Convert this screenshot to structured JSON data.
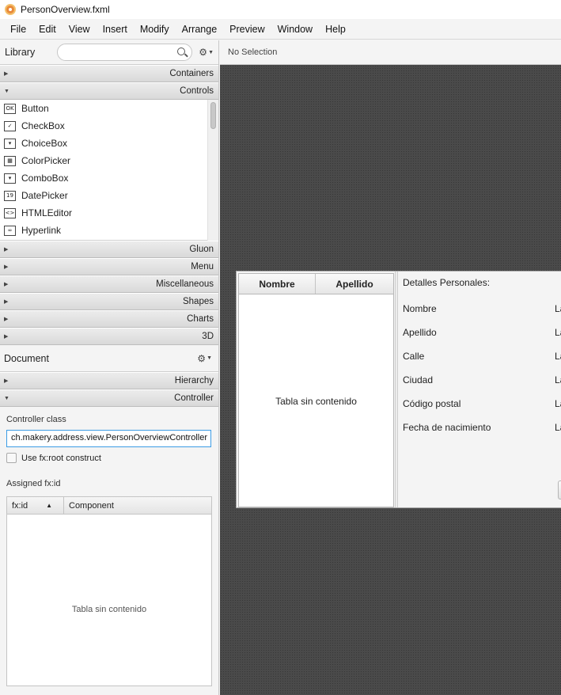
{
  "window": {
    "title": "PersonOverview.fxml"
  },
  "menu": [
    "File",
    "Edit",
    "View",
    "Insert",
    "Modify",
    "Arrange",
    "Preview",
    "Window",
    "Help"
  ],
  "library": {
    "title": "Library",
    "search_placeholder": "",
    "sections_top": [
      {
        "label": "Containers",
        "expanded": false
      },
      {
        "label": "Controls",
        "expanded": true
      }
    ],
    "controls": [
      {
        "label": "Button",
        "icon": "button-icon",
        "glyph": "OK"
      },
      {
        "label": "CheckBox",
        "icon": "checkbox-icon",
        "glyph": "✓"
      },
      {
        "label": "ChoiceBox",
        "icon": "choicebox-icon",
        "glyph": "▾"
      },
      {
        "label": "ColorPicker",
        "icon": "colorpicker-icon",
        "glyph": "▦"
      },
      {
        "label": "ComboBox",
        "icon": "combobox-icon",
        "glyph": "▾"
      },
      {
        "label": "DatePicker",
        "icon": "datepicker-icon",
        "glyph": "19"
      },
      {
        "label": "HTMLEditor",
        "icon": "htmleditor-icon",
        "glyph": "<>"
      },
      {
        "label": "Hyperlink",
        "icon": "hyperlink-icon",
        "glyph": "∞"
      }
    ],
    "sections_bottom": [
      {
        "label": "Gluon"
      },
      {
        "label": "Menu"
      },
      {
        "label": "Miscellaneous"
      },
      {
        "label": "Shapes"
      },
      {
        "label": "Charts"
      },
      {
        "label": "3D"
      }
    ]
  },
  "document": {
    "title": "Document",
    "sections": [
      {
        "label": "Hierarchy",
        "expanded": false
      },
      {
        "label": "Controller",
        "expanded": true
      }
    ],
    "controller_class_label": "Controller class",
    "controller_class_value": "ch.makery.address.view.PersonOverviewController",
    "fx_root_label": "Use fx:root construct",
    "assigned_label": "Assigned fx:id",
    "table": {
      "columns": [
        "fx:id",
        "Component"
      ],
      "sort_indicator": "▲",
      "empty_text": "Tabla sin contenido"
    }
  },
  "canvas": {
    "selection_text": "No Selection",
    "person_table": {
      "columns": [
        "Nombre",
        "Apellido"
      ],
      "empty_text": "Tabla sin contenido"
    },
    "details": {
      "title": "Detalles Personales:",
      "rows": [
        {
          "label": "Nombre",
          "value": "La"
        },
        {
          "label": "Apellido",
          "value": "La"
        },
        {
          "label": "Calle",
          "value": "La"
        },
        {
          "label": "Ciudad",
          "value": "La"
        },
        {
          "label": "Código postal",
          "value": "La"
        },
        {
          "label": "Fecha de nacimiento",
          "value": "La"
        }
      ]
    }
  }
}
